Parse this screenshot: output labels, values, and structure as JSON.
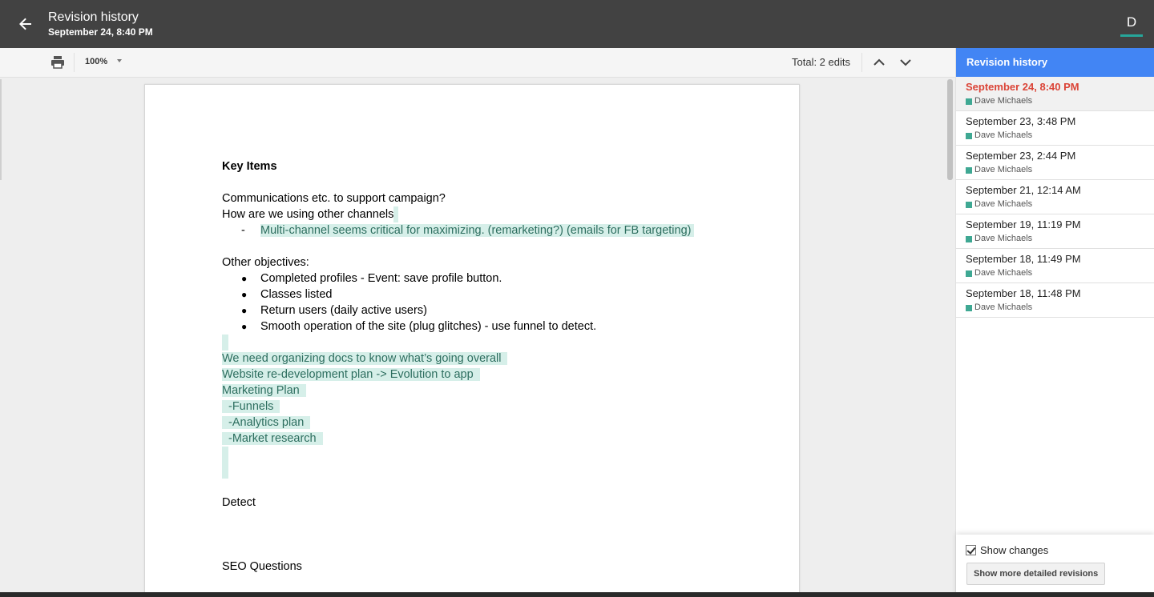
{
  "header": {
    "title": "Revision history",
    "subtitle": "September 24, 8:40 PM",
    "avatar_letter": "D"
  },
  "toolbar": {
    "zoom": "100%",
    "total_edits": "Total: 2 edits"
  },
  "document": {
    "heading": "Key Items",
    "line1": "Communications etc. to support campaign?",
    "line2": "How are we using other channels",
    "dash_item": "Multi-channel seems critical for maximizing. (remarketing?) (emails for FB targeting)",
    "dash_mark": "-",
    "objectives_label": "Other objectives:",
    "bullet_mark": "●",
    "bullets": [
      "Completed profiles  - Event: save profile button.",
      "Classes listed",
      "Return users (daily active users)",
      "Smooth operation of the site (plug glitches) - use funnel to detect."
    ],
    "added_lines": [
      "We need organizing docs to know what’s going overall",
      "Website re-development plan -> Evolution to app",
      "Marketing Plan",
      "  -Funnels",
      "  -Analytics plan",
      "  -Market research"
    ],
    "detect": "Detect",
    "seo": "SEO Questions"
  },
  "panel": {
    "header": "Revision history",
    "revisions": [
      {
        "date": "September 24, 8:40 PM",
        "author": "Dave Michaels"
      },
      {
        "date": "September 23, 3:48 PM",
        "author": "Dave Michaels"
      },
      {
        "date": "September 23, 2:44 PM",
        "author": "Dave Michaels"
      },
      {
        "date": "September 21, 12:14 AM",
        "author": "Dave Michaels"
      },
      {
        "date": "September 19, 11:19 PM",
        "author": "Dave Michaels"
      },
      {
        "date": "September 18, 11:49 PM",
        "author": "Dave Michaels"
      },
      {
        "date": "September 18, 11:48 PM",
        "author": "Dave Michaels"
      }
    ],
    "show_changes_label": "Show changes",
    "detailed_button": "Show more detailed revisions"
  },
  "colors": {
    "topbar": "#424242",
    "panel_header": "#4285f4",
    "active_revision": "#db4437",
    "author_swatch": "#3fa893",
    "highlight": "#d6efe9"
  },
  "icons": {
    "back": "back-arrow-icon",
    "print": "print-icon",
    "up": "chevron-up-icon",
    "down": "chevron-down-icon"
  }
}
